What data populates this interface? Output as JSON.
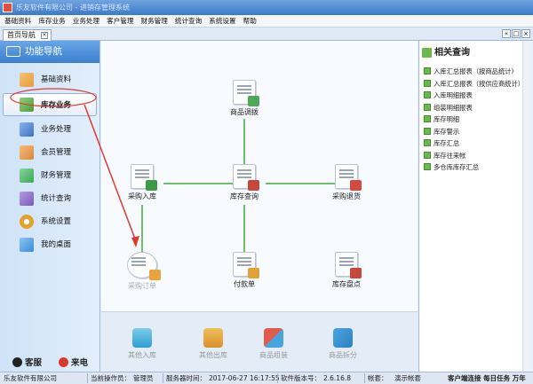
{
  "window": {
    "title": "乐友软件有限公司 - 进销存管理系统"
  },
  "menu": [
    "基础资料",
    "库存业务",
    "业务处理",
    "客户管理",
    "财务管理",
    "统计查询",
    "系统设置",
    "帮助"
  ],
  "tabs": {
    "home_label": "首页导航",
    "close_glyph": "×"
  },
  "window_buttons": [
    "«",
    "□",
    "×"
  ],
  "sidebar": {
    "header": "功能导航",
    "items": [
      {
        "label": "基础资料",
        "icon": "pencil-icon",
        "color": "#e69a3a"
      },
      {
        "label": "库存业务",
        "icon": "house-icon",
        "color": "#4c9a3f"
      },
      {
        "label": "业务处理",
        "icon": "people-icon",
        "color": "#3e6fc4"
      },
      {
        "label": "会员管理",
        "icon": "members-icon",
        "color": "#d8883a"
      },
      {
        "label": "财务管理",
        "icon": "chart-icon",
        "color": "#3aa657"
      },
      {
        "label": "统计查询",
        "icon": "gear-chart-icon",
        "color": "#7b5ab8"
      },
      {
        "label": "系统设置",
        "icon": "gear-icon",
        "color": "#e3a22b"
      },
      {
        "label": "我的桌面",
        "icon": "monitor-icon",
        "color": "#3b8bd9"
      }
    ],
    "service_label": "客服",
    "phone_label": "来电"
  },
  "flow": {
    "transfer": "商品调拨",
    "purchase_in": "采购入库",
    "stock_query": "库存查询",
    "purchase_return": "采购退货",
    "purchase_order": "采购订单",
    "payment": "付款单",
    "inventory_check": "库存盘点"
  },
  "bottom": {
    "other_in": "其他入库",
    "other_out": "其他出库",
    "assemble": "商品组装",
    "split": "商品拆分"
  },
  "right_panel": {
    "header": "相关查询",
    "links": [
      "入库汇总报表（按商品统计）",
      "入库汇总报表（按供应商统计）",
      "入库明细报表",
      "组装明细报表",
      "库存明细",
      "库存警示",
      "库存汇总",
      "库存往来帐",
      "多仓库库存汇总"
    ]
  },
  "status": {
    "company": "乐友软件有限公司",
    "operator_label": "当前操作员：",
    "operator": "管理员",
    "server_time_label": "服务器时间：",
    "server_time": "2017-06-27 16:17:55",
    "version_label": "软件版本号：",
    "version": "2.6.16.8",
    "account_label": "帐套：",
    "account": "演示帐套",
    "client_status": "客户端连接 每日任务 万年"
  },
  "colors": {
    "accent": "#3b7fd0",
    "flow_line": "#6fbf6a",
    "annotation": "#e03a2f"
  }
}
